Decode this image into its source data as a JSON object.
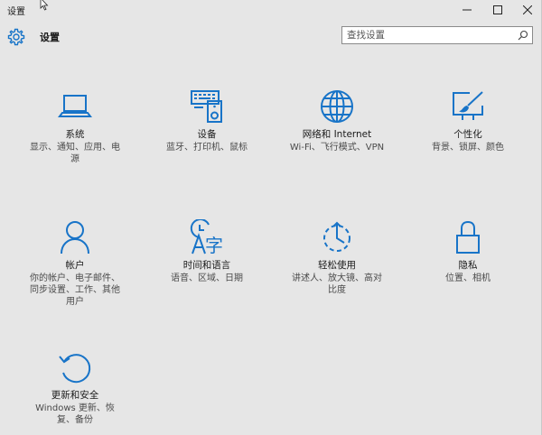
{
  "window": {
    "title": "设置"
  },
  "header": {
    "title": "设置"
  },
  "search": {
    "placeholder": "查找设置"
  },
  "icons": {
    "accent_color": "#1874c8"
  },
  "tiles": [
    {
      "id": "system",
      "icon": "laptop-icon",
      "label": "系统",
      "desc": "显示、通知、应用、电源"
    },
    {
      "id": "devices",
      "icon": "keyboard-speaker-icon",
      "label": "设备",
      "desc": "蓝牙、打印机、鼠标"
    },
    {
      "id": "network",
      "icon": "globe-icon",
      "label": "网络和 Internet",
      "desc": "Wi-Fi、飞行模式、VPN"
    },
    {
      "id": "personalization",
      "icon": "paint-brush-icon",
      "label": "个性化",
      "desc": "背景、锁屏、颜色"
    },
    {
      "id": "accounts",
      "icon": "person-icon",
      "label": "帐户",
      "desc": "你的帐户、电子邮件、同步设置、工作、其他用户"
    },
    {
      "id": "time-language",
      "icon": "time-language-icon",
      "label": "时间和语言",
      "desc": "语音、区域、日期"
    },
    {
      "id": "ease-of-access",
      "icon": "ease-of-access-icon",
      "label": "轻松使用",
      "desc": "讲述人、放大镜、高对比度"
    },
    {
      "id": "privacy",
      "icon": "lock-icon",
      "label": "隐私",
      "desc": "位置、相机"
    },
    {
      "id": "update-security",
      "icon": "refresh-icon",
      "label": "更新和安全",
      "desc": "Windows 更新、恢复、备份"
    }
  ]
}
